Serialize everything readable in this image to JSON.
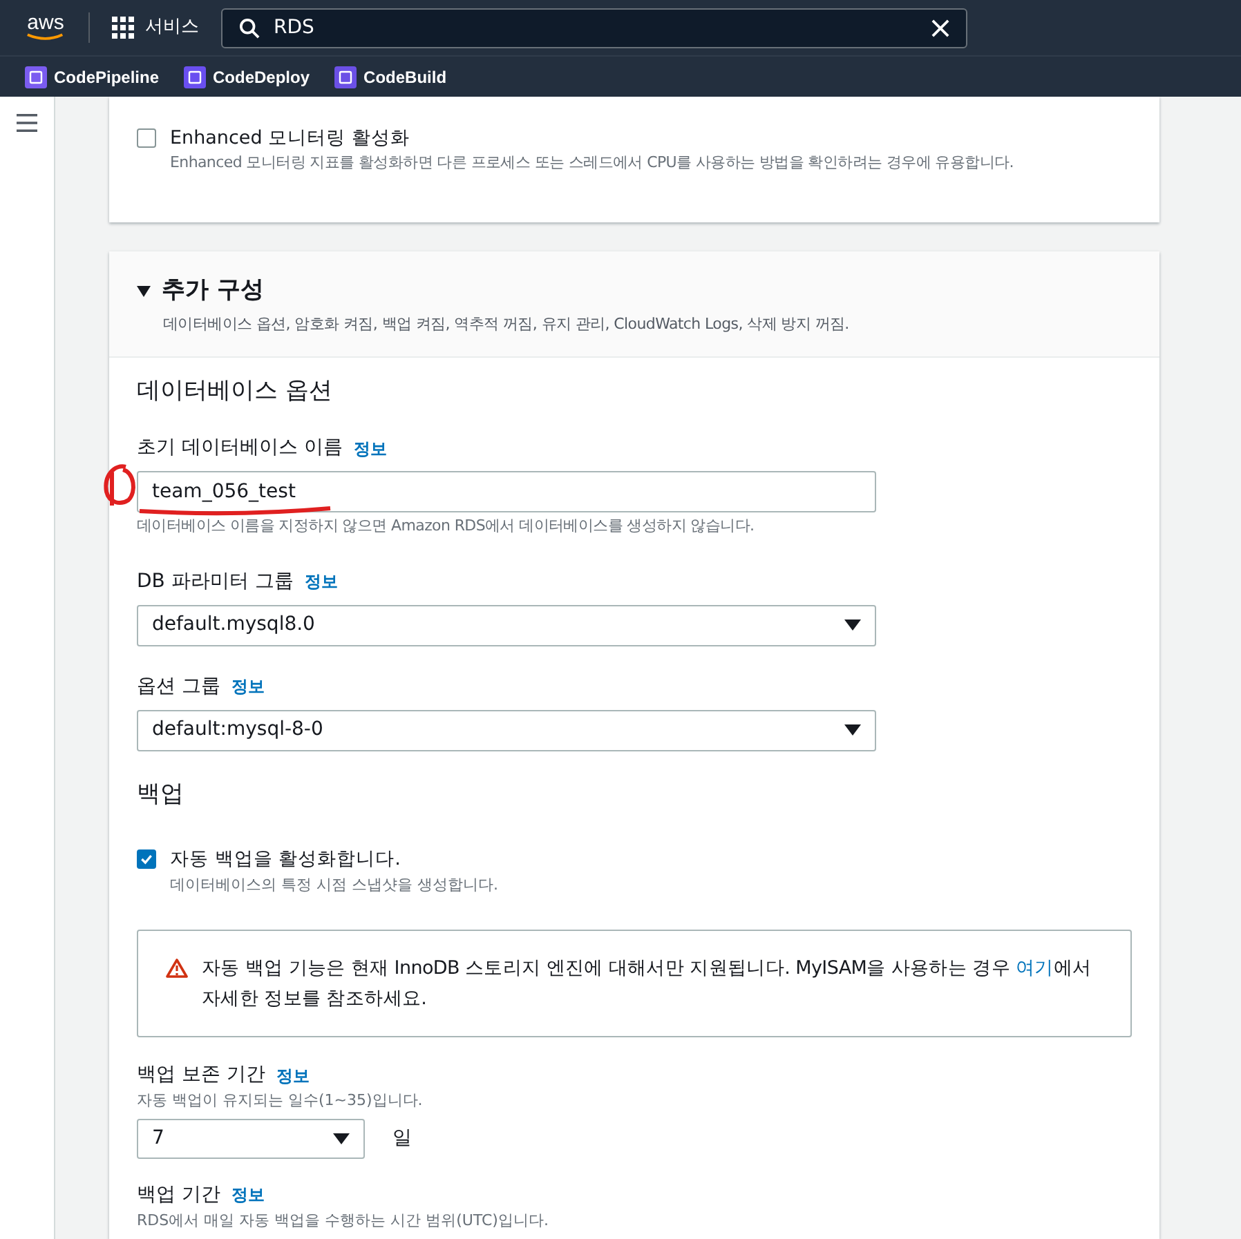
{
  "top_nav": {
    "logo": "aws",
    "services": "서비스",
    "search": {
      "value": "RDS"
    }
  },
  "favorites": [
    {
      "label": "CodePipeline"
    },
    {
      "label": "CodeDeploy"
    },
    {
      "label": "CodeBuild"
    }
  ],
  "monitoring": {
    "checkbox": {
      "label": "Enhanced 모니터링 활성화",
      "description": "Enhanced 모니터링 지표를 활성화하면 다른 프로세스 또는 스레드에서 CPU를 사용하는 방법을 확인하려는 경우에 유용합니다.",
      "checked": false
    }
  },
  "additional_config": {
    "title": "추가 구성",
    "expanded": true,
    "description": "데이터베이스 옵션, 암호화 켜짐, 백업 켜짐, 역추적 꺼짐, 유지 관리, CloudWatch Logs, 삭제 방지 꺼짐.",
    "db_options": {
      "heading": "데이터베이스 옵션",
      "fields": [
        {
          "kind": "input",
          "label": "초기 데이터베이스 이름",
          "info": "정보",
          "value": "team_056_test",
          "hint": "데이터베이스 이름을 지정하지 않으면 Amazon RDS에서 데이터베이스를 생성하지 않습니다."
        },
        {
          "kind": "select",
          "label": "DB 파라미터 그룹",
          "info": "정보",
          "value": "default.mysql8.0"
        },
        {
          "kind": "select",
          "label": "옵션 그룹",
          "info": "정보",
          "value": "default:mysql-8-0"
        }
      ]
    },
    "backup": {
      "heading": "백업",
      "checkbox": {
        "label": "자동 백업을 활성화합니다.",
        "description": "데이터베이스의 특정 시점 스냅샷을 생성합니다.",
        "checked": true
      },
      "alert": {
        "text": "자동 백업 기능은 현재 InnoDB 스토리지 엔진에 대해서만 지원됩니다. MyISAM을 사용하는 경우 ",
        "link": "여기",
        "text_after": "에서 자세한 정보를 참조하세요."
      },
      "retention": {
        "label": "백업 보존 기간",
        "info": "정보",
        "description": "자동 백업이 유지되는 일수(1~35)입니다.",
        "value": "7",
        "unit": "일"
      },
      "window": {
        "label": "백업 기간",
        "info": "정보",
        "description": "RDS에서 매일 자동 백업을 수행하는 시간 범위(UTC)입니다."
      }
    }
  }
}
